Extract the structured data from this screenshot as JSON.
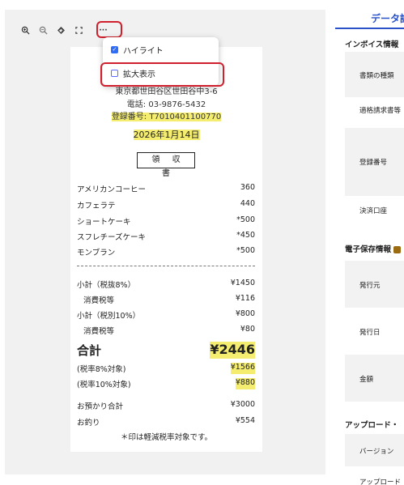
{
  "toolbar": {
    "zoom_in_icon": "zoom-in-icon",
    "zoom_out_icon": "zoom-out-icon",
    "rotate_icon": "rotate-icon",
    "fit_icon": "fit-screen-icon",
    "more_label": "···"
  },
  "menu": {
    "items": [
      {
        "label": "ハイライト",
        "checked": true
      },
      {
        "label": "拡大表示",
        "checked": false
      }
    ]
  },
  "receipt": {
    "address": "東京都世田谷区世田谷中3-6",
    "phone": "電話: 03-9876-5432",
    "registration": "登録番号: T7010401100770",
    "date": "2026年1月14日",
    "title": "領 収 書",
    "items": [
      {
        "name": "アメリカンコーヒー",
        "price": "360"
      },
      {
        "name": "カフェラテ",
        "price": "440"
      },
      {
        "name": "ショートケーキ",
        "price": "*500"
      },
      {
        "name": "スフレチーズケーキ",
        "price": "*450"
      },
      {
        "name": "モンブラン",
        "price": "*500"
      }
    ],
    "subtotal8_label": "小計（税抜8%）",
    "subtotal8": "¥1450",
    "tax8_label": "消費税等",
    "tax8": "¥116",
    "subtotal10_label": "小計（税別10%）",
    "subtotal10": "¥800",
    "tax10_label": "消費税等",
    "tax10": "¥80",
    "total_label": "合計",
    "total": "¥2446",
    "target8_label": "(税率8%対象)",
    "target8": "¥1566",
    "target10_label": "(税率10%対象)",
    "target10": "¥880",
    "deposit_label": "お預かり合計",
    "deposit": "¥3000",
    "change_label": "お釣り",
    "change": "¥554",
    "note": "＊印は軽減税率対象です。",
    "highlight_color": "#f4ed70"
  },
  "panel": {
    "tab": "データ詳",
    "invoice_header": "インボイス情報",
    "invoice_rows": [
      "書類の種類",
      "適格請求書等",
      "登録番号",
      "決済口座"
    ],
    "storage_header": "電子保存情報",
    "storage_rows": [
      "発行元",
      "発行日",
      "金額"
    ],
    "upload_header": "アップロード・",
    "upload_rows": [
      "バージョン",
      "アップロード"
    ],
    "accent_color": "#2a52c9"
  }
}
